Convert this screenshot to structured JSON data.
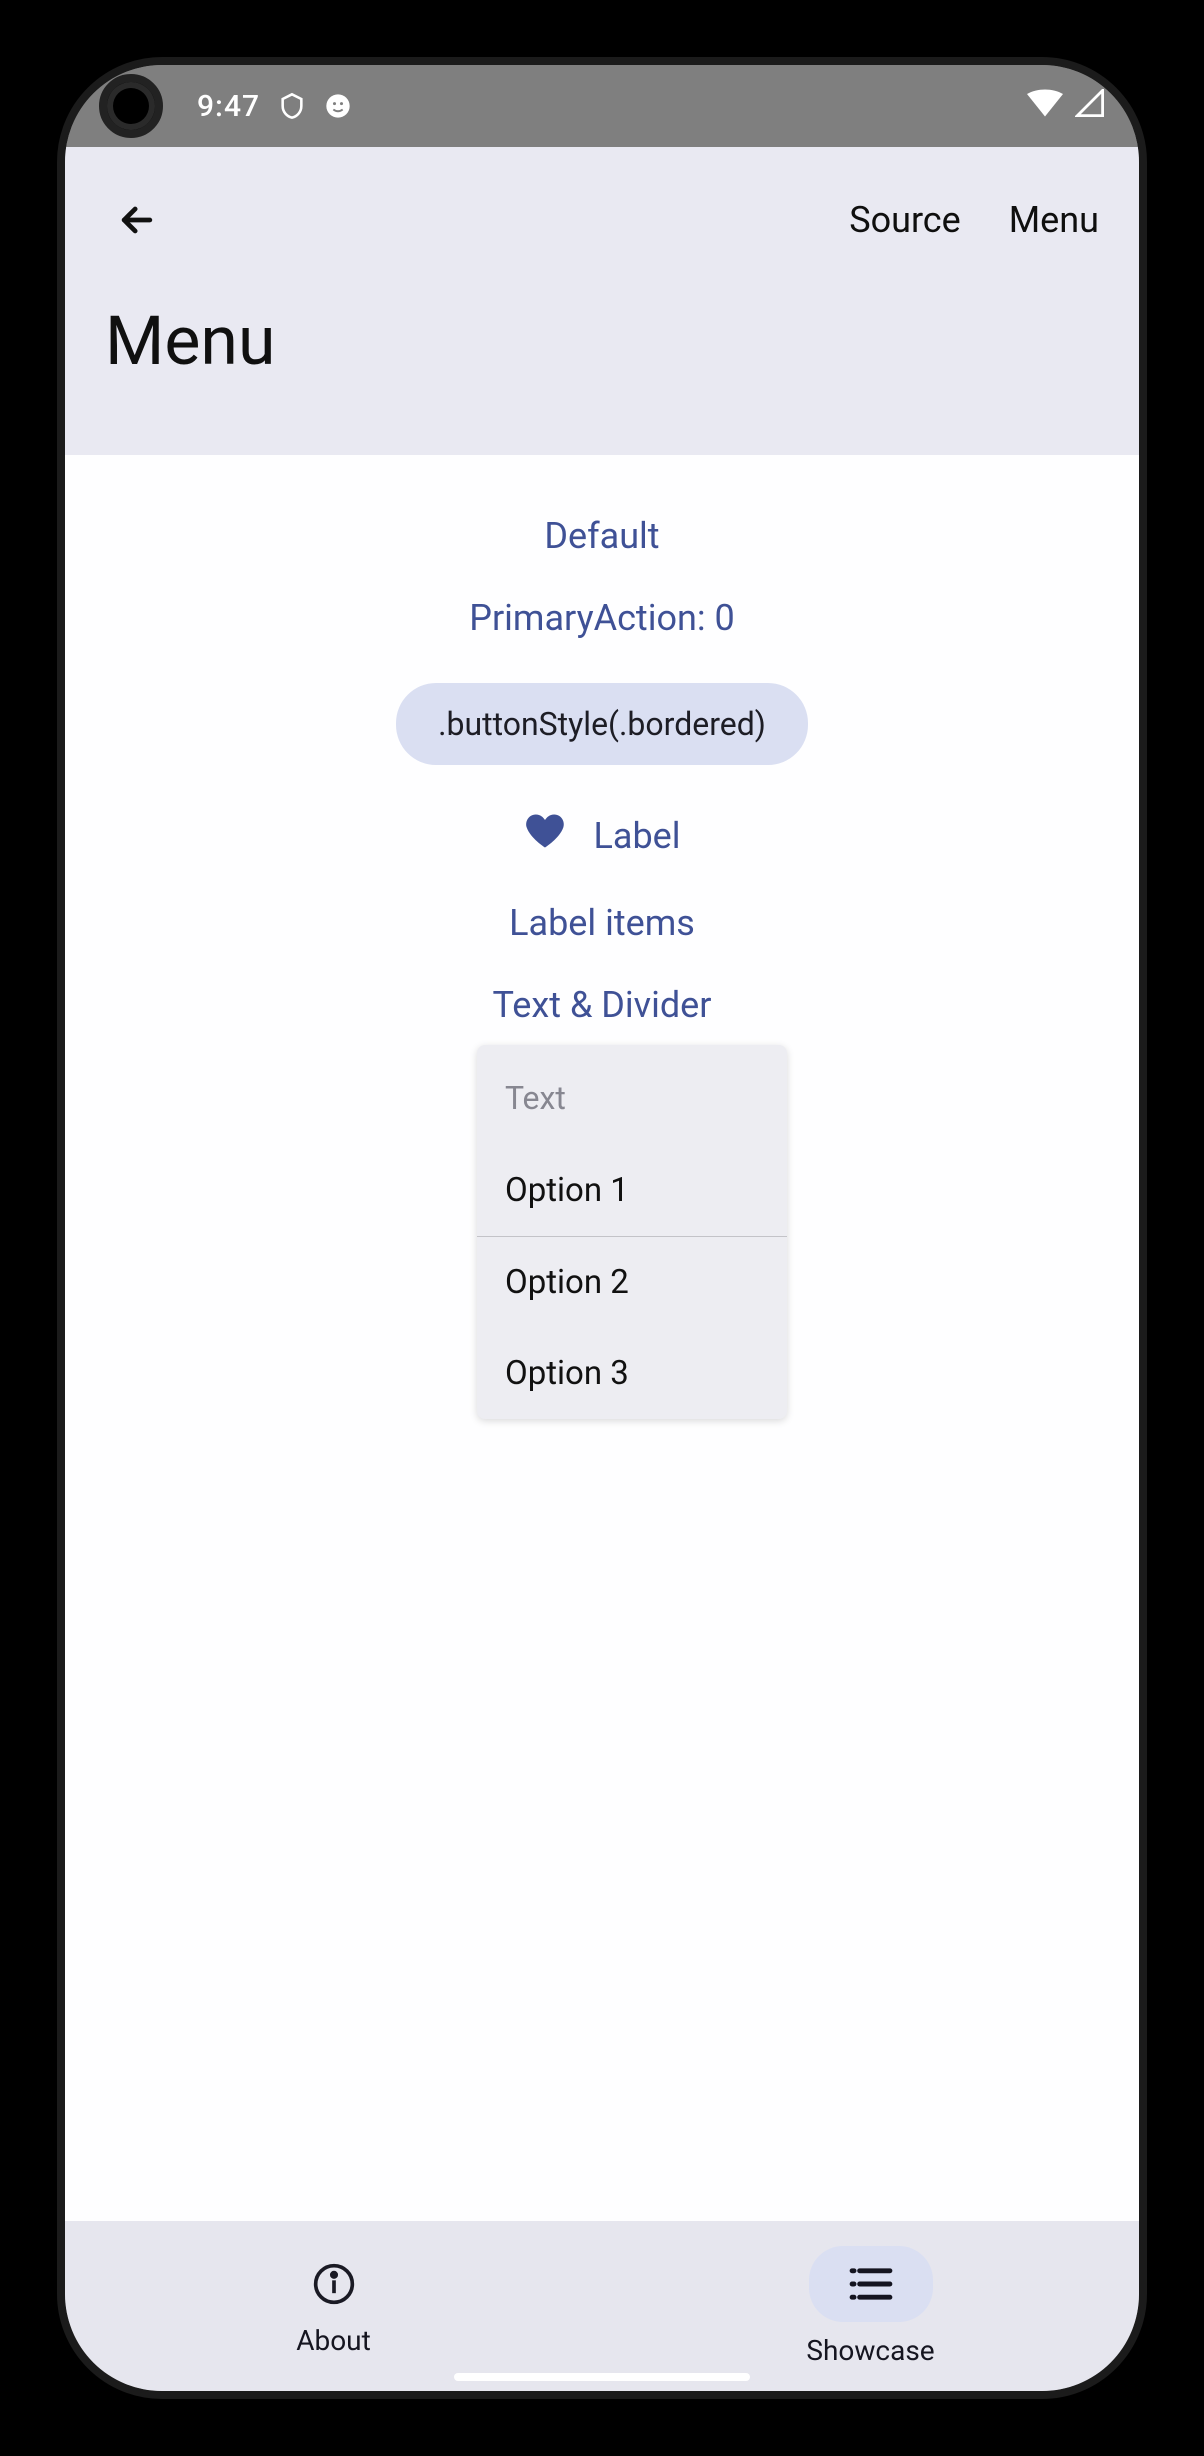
{
  "statusbar": {
    "time": "9:47"
  },
  "header": {
    "actions": {
      "source": "Source",
      "menu": "Menu"
    },
    "title": "Menu"
  },
  "content": {
    "default": "Default",
    "primaryAction": "PrimaryAction: 0",
    "bordered": ".buttonStyle(.bordered)",
    "label": "Label",
    "labelItems": "Label items",
    "textDivider": "Text & Divider"
  },
  "popup": {
    "header": "Text",
    "options": [
      "Option 1",
      "Option 2",
      "Option 3"
    ]
  },
  "tabs": {
    "about": "About",
    "showcase": "Showcase"
  }
}
